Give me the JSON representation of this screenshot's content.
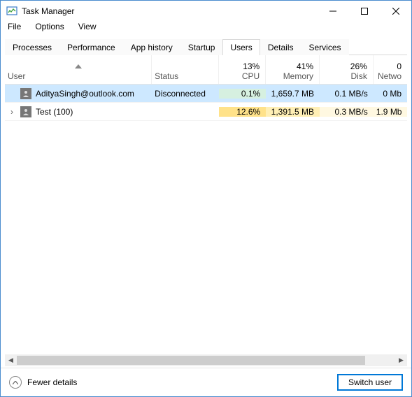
{
  "window": {
    "title": "Task Manager"
  },
  "menu": {
    "file": "File",
    "options": "Options",
    "view": "View"
  },
  "tabs": {
    "processes": "Processes",
    "performance": "Performance",
    "apphistory": "App history",
    "startup": "Startup",
    "users": "Users",
    "details": "Details",
    "services": "Services"
  },
  "headers": {
    "user": "User",
    "status": "Status",
    "cpu_pct": "13%",
    "cpu": "CPU",
    "mem_pct": "41%",
    "mem": "Memory",
    "disk_pct": "26%",
    "disk": "Disk",
    "net_pct": "0",
    "net": "Netwo"
  },
  "rows": [
    {
      "expand": "",
      "user": "AdityaSingh@outlook.com",
      "status": "Disconnected",
      "cpu": "0.1%",
      "mem": "1,659.7 MB",
      "disk": "0.1 MB/s",
      "net": "0 Mb",
      "selected": true
    },
    {
      "expand": "›",
      "user": "Test (100)",
      "status": "",
      "cpu": "12.6%",
      "mem": "1,391.5 MB",
      "disk": "0.3 MB/s",
      "net": "1.9 Mb",
      "selected": false
    }
  ],
  "footer": {
    "fewer": "Fewer details",
    "switch": "Switch user"
  }
}
